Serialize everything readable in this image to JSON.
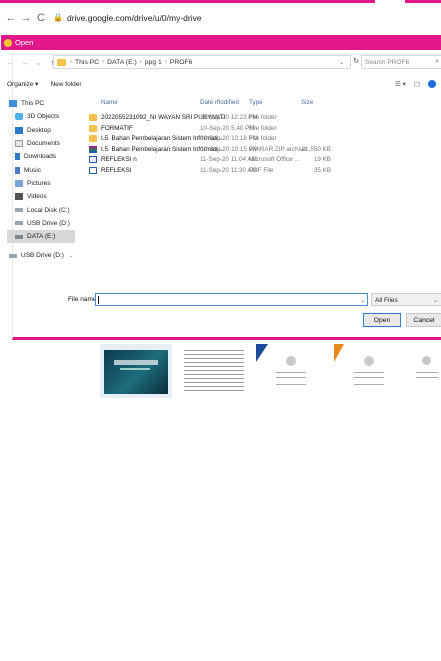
{
  "browser": {
    "back": "←",
    "forward": "→",
    "reload": "C",
    "url": "drive.google.com/drive/u/0/my-drive"
  },
  "dialog": {
    "title": "Open",
    "breadcrumb": [
      "This PC",
      "DATA (E:)",
      "ppg 1",
      "PROF6"
    ],
    "search_placeholder": "Search PROF6",
    "organize": "Organize ▾",
    "new_folder": "New folder",
    "nav": [
      "This PC",
      "3D Objects",
      "Desktop",
      "Documents",
      "Downloads",
      "Music",
      "Pictures",
      "Videos",
      "Local Disk (C:)",
      "USB Drive (D:)",
      "DATA (E:)",
      "USB Drive (D:)"
    ],
    "columns": {
      "name": "Name",
      "date": "Date modified",
      "type": "Type",
      "size": "Size"
    },
    "files": [
      {
        "name": "2022055231092_NI WAYAN SRI PURYANTI",
        "date": "11-Sep-20 12:23 PM",
        "type": "File folder",
        "size": "",
        "icon": "folder"
      },
      {
        "name": "FORMATIF",
        "date": "10-Sep-20 5:40 PM",
        "type": "File folder",
        "size": "",
        "icon": "folder"
      },
      {
        "name": "I.5. Bahan Pembelajaran Sistem Informati...",
        "date": "09-Sep-20 10:18 PM",
        "type": "File folder",
        "size": "",
        "icon": "folder"
      },
      {
        "name": "I.5. Bahan Pembelajaran Sistem Informati...",
        "date": "09-Sep-20 10:15 PM",
        "type": "WinRAR ZIP archive",
        "size": "21,550 KB",
        "icon": "rar"
      },
      {
        "name": "REFLEKSI n",
        "date": "11-Sep-20 11:04 AM",
        "type": "Microsoft Office ...",
        "size": "19 KB",
        "icon": "word"
      },
      {
        "name": "REFLEKSI",
        "date": "11-Sep-20 11:30 AM",
        "type": "PDF File",
        "size": "35 KB",
        "icon": "doc"
      }
    ],
    "file_name_label": "File name:",
    "file_name_value": "",
    "file_type_filter": "All Files",
    "open_button": "Open",
    "cancel_button": "Cancel"
  },
  "colors": {
    "accent": "#e1178a"
  }
}
